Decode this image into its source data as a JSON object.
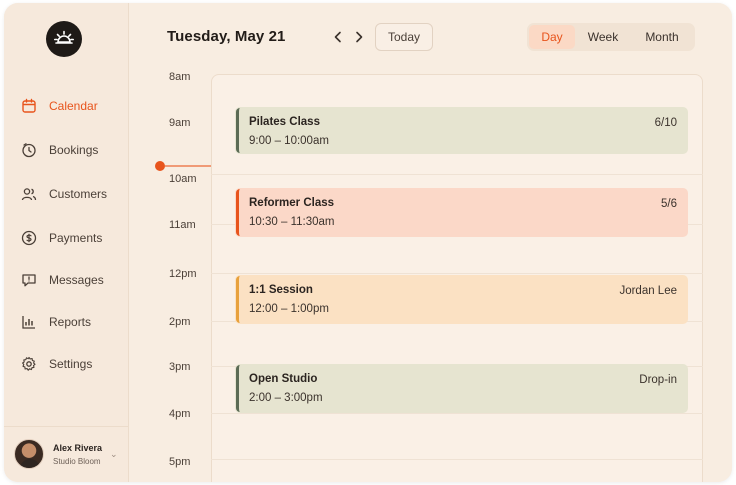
{
  "sidebar": {
    "items": [
      {
        "label": "Calendar",
        "icon": "calendar-icon",
        "active": true
      },
      {
        "label": "Bookings",
        "icon": "bookings-icon"
      },
      {
        "label": "Customers",
        "icon": "users-icon"
      },
      {
        "label": "Payments",
        "icon": "dollar-icon"
      },
      {
        "label": "Messages",
        "icon": "message-icon"
      },
      {
        "label": "Reports",
        "icon": "chart-icon"
      },
      {
        "label": "Settings",
        "icon": "gear-icon"
      }
    ],
    "user": {
      "name": "Alex Rivera",
      "org": "Studio Bloom"
    }
  },
  "header": {
    "date": "Tuesday, May 21",
    "today_label": "Today",
    "views": [
      "Day",
      "Week",
      "Month"
    ],
    "active_view": "Day"
  },
  "timeline": {
    "hours": [
      "8am",
      "9am",
      "10am",
      "11am",
      "12pm",
      "2pm",
      "3pm",
      "4pm",
      "5pm"
    ]
  },
  "events": [
    {
      "title": "Pilates Class",
      "time": "9:00 – 10:00am",
      "meta": "6/10",
      "color": "#e6e4d0",
      "border": "#5c6b55"
    },
    {
      "title": "Reformer Class",
      "time": "10:30 – 11:30am",
      "meta": "5/6",
      "color": "#fbd8c8",
      "border": "#e8541c"
    },
    {
      "title": "1:1 Session",
      "time": "12:00 – 1:00pm",
      "meta": "Jordan Lee",
      "color": "#fbe1c3",
      "border": "#e8a13c"
    },
    {
      "title": "Open Studio",
      "time": "2:00 – 3:00pm",
      "meta": "Drop-in",
      "color": "#e6e4d0",
      "border": "#5c6b55"
    }
  ],
  "colors": {
    "accent": "#e8541c",
    "background": "#f8ede1"
  }
}
